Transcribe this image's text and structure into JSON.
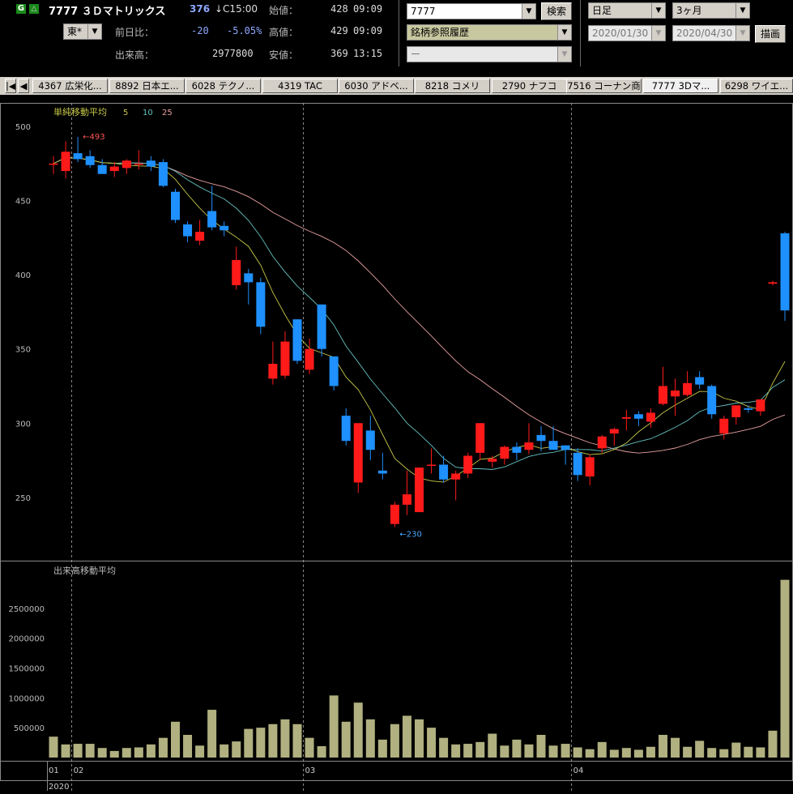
{
  "header": {
    "code_name": "7777 ３Ｄマトリックス",
    "price": "376",
    "price_time": "↓C15:00",
    "exchange": "東*",
    "prev_label": "前日比：",
    "prev_change": "-20",
    "prev_pct": "-5.05%",
    "volume_label": "出来高：",
    "volume": "2977800",
    "open_label": "始値：",
    "open_val": "428",
    "open_time": "09:09",
    "high_label": "高値：",
    "high_val": "429",
    "high_time": "09:09",
    "low_label": "安値：",
    "low_val": "369",
    "low_time": "13:15",
    "search_code": "7777",
    "search_button": "検索",
    "history_select": "銘柄参照履歴",
    "third_select": "ー",
    "period_select": "日足",
    "range_select": "3ヶ月",
    "date_from": "2020/01/30",
    "date_to": "2020/04/30",
    "draw_button": "描画"
  },
  "tabs": [
    {
      "label": "4367 広栄化..."
    },
    {
      "label": "8892 日本エ..."
    },
    {
      "label": "6028 テクノ..."
    },
    {
      "label": "4319 TAC"
    },
    {
      "label": "6030 アドベ..."
    },
    {
      "label": "8218 コメリ"
    },
    {
      "label": "2790 ナフコ"
    },
    {
      "label": "7516 コーナン商"
    },
    {
      "label": "7777 3Dマ..."
    },
    {
      "label": "6298 ワイエ..."
    }
  ],
  "colors": {
    "up": "#ff1a1a",
    "down": "#1e90ff",
    "ma5": "#c8c84a",
    "ma10": "#66c0c0",
    "ma25": "#e8a0a0",
    "volume": "#b0b080"
  },
  "chart_data": {
    "type": "candlestick",
    "title": "単純移動平均",
    "ma_periods": [
      "5",
      "10",
      "25"
    ],
    "volume_title": "出来高移動平均",
    "ylim": [
      210,
      505
    ],
    "yticks": [
      250,
      300,
      350,
      400,
      450,
      500
    ],
    "volume_ylim": [
      0,
      3000000
    ],
    "volume_ticks": [
      500000,
      1000000,
      1500000,
      2000000,
      2500000
    ],
    "annotations": [
      {
        "label": "←493"
      },
      {
        "label": "←230"
      }
    ],
    "x_labels": [
      {
        "label": "01",
        "index": 0
      },
      {
        "label": "02",
        "index": 1.5
      },
      {
        "label": "03",
        "index": 20.5
      },
      {
        "label": "04",
        "index": 42.5
      }
    ],
    "year_label": "2020",
    "candles": [
      {
        "o": 475,
        "h": 480,
        "l": 468,
        "c": 475,
        "v": 350000
      },
      {
        "o": 470,
        "h": 490,
        "l": 465,
        "c": 483,
        "v": 220000
      },
      {
        "o": 482,
        "h": 493,
        "l": 476,
        "c": 478,
        "v": 230000
      },
      {
        "o": 480,
        "h": 484,
        "l": 472,
        "c": 474,
        "v": 230000
      },
      {
        "o": 474,
        "h": 478,
        "l": 468,
        "c": 468,
        "v": 160000
      },
      {
        "o": 470,
        "h": 476,
        "l": 466,
        "c": 473,
        "v": 110000
      },
      {
        "o": 472,
        "h": 478,
        "l": 468,
        "c": 477,
        "v": 160000
      },
      {
        "o": 475,
        "h": 484,
        "l": 471,
        "c": 475,
        "v": 170000
      },
      {
        "o": 477,
        "h": 480,
        "l": 470,
        "c": 473,
        "v": 220000
      },
      {
        "o": 476,
        "h": 478,
        "l": 459,
        "c": 460,
        "v": 330000
      },
      {
        "o": 456,
        "h": 458,
        "l": 435,
        "c": 437,
        "v": 600000
      },
      {
        "o": 434,
        "h": 436,
        "l": 422,
        "c": 426,
        "v": 380000
      },
      {
        "o": 423,
        "h": 437,
        "l": 420,
        "c": 429,
        "v": 200000
      },
      {
        "o": 443,
        "h": 460,
        "l": 430,
        "c": 432,
        "v": 800000
      },
      {
        "o": 433,
        "h": 436,
        "l": 426,
        "c": 430,
        "v": 220000
      },
      {
        "o": 393,
        "h": 419,
        "l": 390,
        "c": 410,
        "v": 270000
      },
      {
        "o": 401,
        "h": 404,
        "l": 380,
        "c": 395,
        "v": 480000
      },
      {
        "o": 395,
        "h": 398,
        "l": 360,
        "c": 365,
        "v": 500000
      },
      {
        "o": 330,
        "h": 355,
        "l": 326,
        "c": 340,
        "v": 560000
      },
      {
        "o": 332,
        "h": 362,
        "l": 330,
        "c": 355,
        "v": 640000
      },
      {
        "o": 370,
        "h": 370,
        "l": 340,
        "c": 342,
        "v": 560000
      },
      {
        "o": 336,
        "h": 357,
        "l": 333,
        "c": 350,
        "v": 330000
      },
      {
        "o": 380,
        "h": 380,
        "l": 345,
        "c": 350,
        "v": 190000
      },
      {
        "o": 345,
        "h": 345,
        "l": 322,
        "c": 325,
        "v": 1040000
      },
      {
        "o": 305,
        "h": 310,
        "l": 285,
        "c": 288,
        "v": 600000
      },
      {
        "o": 260,
        "h": 300,
        "l": 253,
        "c": 300,
        "v": 920000
      },
      {
        "o": 295,
        "h": 305,
        "l": 275,
        "c": 282,
        "v": 640000
      },
      {
        "o": 268,
        "h": 280,
        "l": 262,
        "c": 266,
        "v": 300000
      },
      {
        "o": 232,
        "h": 247,
        "l": 230,
        "c": 245,
        "v": 560000
      },
      {
        "o": 245,
        "h": 268,
        "l": 238,
        "c": 252,
        "v": 700000
      },
      {
        "o": 240,
        "h": 270,
        "l": 240,
        "c": 270,
        "v": 640000
      },
      {
        "o": 272,
        "h": 283,
        "l": 266,
        "c": 272,
        "v": 500000
      },
      {
        "o": 272,
        "h": 278,
        "l": 260,
        "c": 262,
        "v": 330000
      },
      {
        "o": 262,
        "h": 268,
        "l": 248,
        "c": 266,
        "v": 220000
      },
      {
        "o": 266,
        "h": 280,
        "l": 263,
        "c": 278,
        "v": 230000
      },
      {
        "o": 280,
        "h": 300,
        "l": 275,
        "c": 300,
        "v": 260000
      },
      {
        "o": 274,
        "h": 278,
        "l": 270,
        "c": 276,
        "v": 400000
      },
      {
        "o": 276,
        "h": 285,
        "l": 272,
        "c": 284,
        "v": 200000
      },
      {
        "o": 284,
        "h": 287,
        "l": 275,
        "c": 280,
        "v": 300000
      },
      {
        "o": 282,
        "h": 300,
        "l": 279,
        "c": 287,
        "v": 220000
      },
      {
        "o": 292,
        "h": 298,
        "l": 281,
        "c": 288,
        "v": 380000
      },
      {
        "o": 288,
        "h": 298,
        "l": 285,
        "c": 282,
        "v": 200000
      },
      {
        "o": 285,
        "h": 285,
        "l": 272,
        "c": 282,
        "v": 230000
      },
      {
        "o": 280,
        "h": 283,
        "l": 261,
        "c": 265,
        "v": 170000
      },
      {
        "o": 264,
        "h": 279,
        "l": 258,
        "c": 277,
        "v": 140000
      },
      {
        "o": 283,
        "h": 292,
        "l": 280,
        "c": 291,
        "v": 260000
      },
      {
        "o": 293,
        "h": 297,
        "l": 285,
        "c": 296,
        "v": 130000
      },
      {
        "o": 303,
        "h": 309,
        "l": 295,
        "c": 304,
        "v": 160000
      },
      {
        "o": 306,
        "h": 308,
        "l": 298,
        "c": 303,
        "v": 130000
      },
      {
        "o": 301,
        "h": 310,
        "l": 297,
        "c": 307,
        "v": 180000
      },
      {
        "o": 313,
        "h": 338,
        "l": 312,
        "c": 325,
        "v": 380000
      },
      {
        "o": 318,
        "h": 330,
        "l": 305,
        "c": 322,
        "v": 330000
      },
      {
        "o": 319,
        "h": 335,
        "l": 318,
        "c": 327,
        "v": 180000
      },
      {
        "o": 331,
        "h": 335,
        "l": 323,
        "c": 326,
        "v": 280000
      },
      {
        "o": 325,
        "h": 326,
        "l": 303,
        "c": 306,
        "v": 160000
      },
      {
        "o": 293,
        "h": 305,
        "l": 289,
        "c": 303,
        "v": 140000
      },
      {
        "o": 304,
        "h": 312,
        "l": 299,
        "c": 312,
        "v": 250000
      },
      {
        "o": 310,
        "h": 312,
        "l": 307,
        "c": 309,
        "v": 180000
      },
      {
        "o": 308,
        "h": 316,
        "l": 305,
        "c": 316,
        "v": 170000
      },
      {
        "o": 394,
        "h": 396,
        "l": 393,
        "c": 395,
        "v": 450000
      },
      {
        "o": 428,
        "h": 429,
        "l": 369,
        "c": 376,
        "v": 2977800
      }
    ]
  }
}
